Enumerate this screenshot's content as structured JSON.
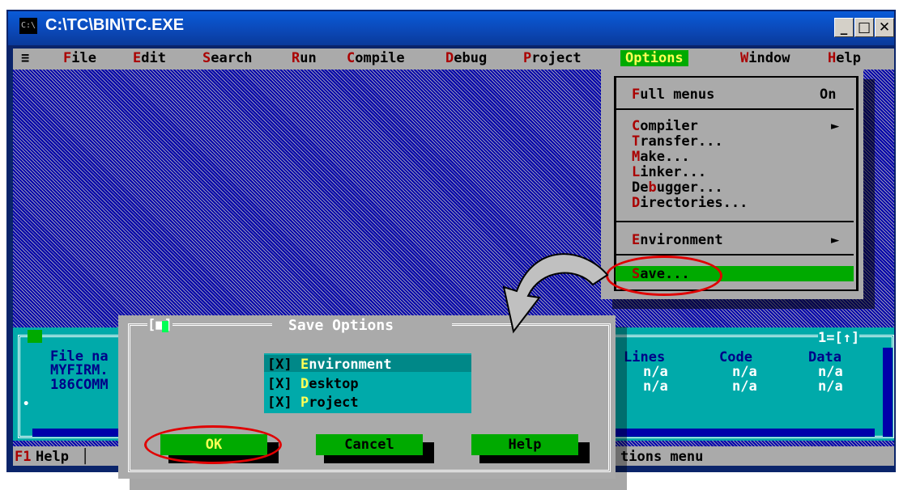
{
  "window": {
    "title": "C:\\TC\\BIN\\TC.EXE",
    "icon_label": "C:\\",
    "minimize": "_",
    "maximize": "□",
    "close": "✕"
  },
  "menubar": {
    "system": "≡",
    "items": [
      {
        "hot": "F",
        "rest": "ile"
      },
      {
        "hot": "E",
        "rest": "dit"
      },
      {
        "hot": "S",
        "rest": "earch"
      },
      {
        "hot": "R",
        "rest": "un"
      },
      {
        "hot": "C",
        "rest": "ompile"
      },
      {
        "hot": "D",
        "rest": "ebug"
      },
      {
        "hot": "P",
        "rest": "roject"
      },
      {
        "hot": "O",
        "rest": "ptions"
      },
      {
        "hot": "W",
        "rest": "indow"
      },
      {
        "hot": "H",
        "rest": "elp"
      }
    ]
  },
  "options_menu": {
    "full_menus": {
      "hot": "F",
      "rest": "ull menus",
      "value": "On"
    },
    "items": [
      {
        "pre": "",
        "hot": "C",
        "rest": "ompiler"
      },
      {
        "pre": "",
        "hot": "T",
        "rest": "ransfer..."
      },
      {
        "pre": "",
        "hot": "M",
        "rest": "ake..."
      },
      {
        "pre": "",
        "hot": "L",
        "rest": "inker..."
      },
      {
        "pre": "De",
        "hot": "b",
        "rest": "ugger..."
      },
      {
        "pre": "",
        "hot": "D",
        "rest": "irectories..."
      }
    ],
    "environment": {
      "hot": "E",
      "rest": "nvironment"
    },
    "save": {
      "hot": "S",
      "rest": "ave..."
    },
    "submenu_arrow": "►"
  },
  "message_window": {
    "left_lines": [
      "File na",
      "MYFIRM.",
      "186COMM"
    ],
    "headers": {
      "lines": "Lines",
      "code": "Code",
      "data": "Data"
    },
    "rows": [
      {
        "lines": "n/a",
        "code": "n/a",
        "data": "n/a"
      },
      {
        "lines": "n/a",
        "code": "n/a",
        "data": "n/a"
      }
    ],
    "corner_label": "1=[↑]",
    "bullet": "•"
  },
  "statusbar": {
    "key": "F1",
    "help": "Help",
    "sep": "│",
    "hint_tail": "tions menu"
  },
  "dialog": {
    "title": "Save Options",
    "close_marker": "[■]",
    "checkboxes": [
      {
        "box": "[X]",
        "hot": "E",
        "rest": "nvironment"
      },
      {
        "box": "[X]",
        "hot": "D",
        "rest": "esktop"
      },
      {
        "box": "[X]",
        "hot": "P",
        "rest": "roject"
      }
    ],
    "buttons": {
      "ok": "OK",
      "cancel": "Cancel",
      "help": "Help"
    }
  },
  "colors": {
    "console_blue": "#0000aa",
    "menu_gray": "#aaaaaa",
    "highlight_green": "#00aa00",
    "hotkey_red": "#aa0000",
    "annotation_red": "#e00000"
  }
}
